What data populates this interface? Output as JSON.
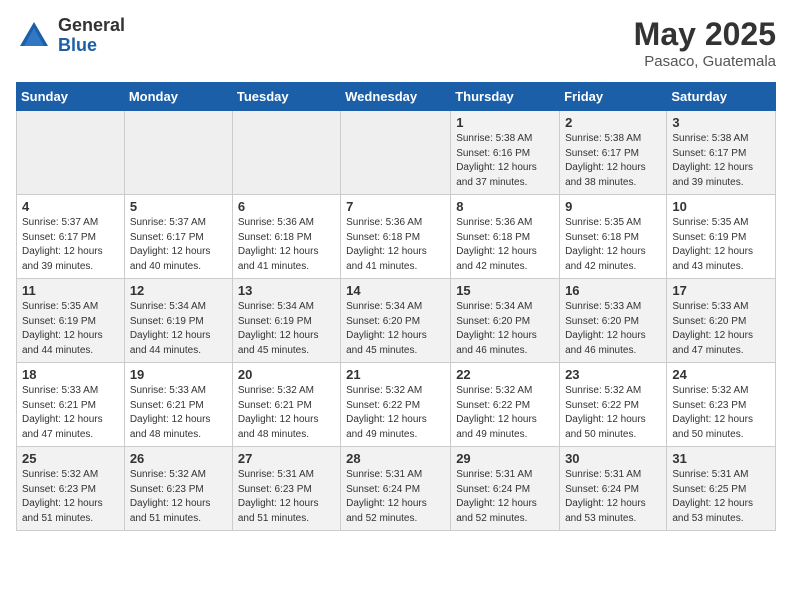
{
  "logo": {
    "general": "General",
    "blue": "Blue"
  },
  "title": "May 2025",
  "location": "Pasaco, Guatemala",
  "days_of_week": [
    "Sunday",
    "Monday",
    "Tuesday",
    "Wednesday",
    "Thursday",
    "Friday",
    "Saturday"
  ],
  "weeks": [
    [
      {
        "day": "",
        "info": ""
      },
      {
        "day": "",
        "info": ""
      },
      {
        "day": "",
        "info": ""
      },
      {
        "day": "",
        "info": ""
      },
      {
        "day": "1",
        "info": "Sunrise: 5:38 AM\nSunset: 6:16 PM\nDaylight: 12 hours\nand 37 minutes."
      },
      {
        "day": "2",
        "info": "Sunrise: 5:38 AM\nSunset: 6:17 PM\nDaylight: 12 hours\nand 38 minutes."
      },
      {
        "day": "3",
        "info": "Sunrise: 5:38 AM\nSunset: 6:17 PM\nDaylight: 12 hours\nand 39 minutes."
      }
    ],
    [
      {
        "day": "4",
        "info": "Sunrise: 5:37 AM\nSunset: 6:17 PM\nDaylight: 12 hours\nand 39 minutes."
      },
      {
        "day": "5",
        "info": "Sunrise: 5:37 AM\nSunset: 6:17 PM\nDaylight: 12 hours\nand 40 minutes."
      },
      {
        "day": "6",
        "info": "Sunrise: 5:36 AM\nSunset: 6:18 PM\nDaylight: 12 hours\nand 41 minutes."
      },
      {
        "day": "7",
        "info": "Sunrise: 5:36 AM\nSunset: 6:18 PM\nDaylight: 12 hours\nand 41 minutes."
      },
      {
        "day": "8",
        "info": "Sunrise: 5:36 AM\nSunset: 6:18 PM\nDaylight: 12 hours\nand 42 minutes."
      },
      {
        "day": "9",
        "info": "Sunrise: 5:35 AM\nSunset: 6:18 PM\nDaylight: 12 hours\nand 42 minutes."
      },
      {
        "day": "10",
        "info": "Sunrise: 5:35 AM\nSunset: 6:19 PM\nDaylight: 12 hours\nand 43 minutes."
      }
    ],
    [
      {
        "day": "11",
        "info": "Sunrise: 5:35 AM\nSunset: 6:19 PM\nDaylight: 12 hours\nand 44 minutes."
      },
      {
        "day": "12",
        "info": "Sunrise: 5:34 AM\nSunset: 6:19 PM\nDaylight: 12 hours\nand 44 minutes."
      },
      {
        "day": "13",
        "info": "Sunrise: 5:34 AM\nSunset: 6:19 PM\nDaylight: 12 hours\nand 45 minutes."
      },
      {
        "day": "14",
        "info": "Sunrise: 5:34 AM\nSunset: 6:20 PM\nDaylight: 12 hours\nand 45 minutes."
      },
      {
        "day": "15",
        "info": "Sunrise: 5:34 AM\nSunset: 6:20 PM\nDaylight: 12 hours\nand 46 minutes."
      },
      {
        "day": "16",
        "info": "Sunrise: 5:33 AM\nSunset: 6:20 PM\nDaylight: 12 hours\nand 46 minutes."
      },
      {
        "day": "17",
        "info": "Sunrise: 5:33 AM\nSunset: 6:20 PM\nDaylight: 12 hours\nand 47 minutes."
      }
    ],
    [
      {
        "day": "18",
        "info": "Sunrise: 5:33 AM\nSunset: 6:21 PM\nDaylight: 12 hours\nand 47 minutes."
      },
      {
        "day": "19",
        "info": "Sunrise: 5:33 AM\nSunset: 6:21 PM\nDaylight: 12 hours\nand 48 minutes."
      },
      {
        "day": "20",
        "info": "Sunrise: 5:32 AM\nSunset: 6:21 PM\nDaylight: 12 hours\nand 48 minutes."
      },
      {
        "day": "21",
        "info": "Sunrise: 5:32 AM\nSunset: 6:22 PM\nDaylight: 12 hours\nand 49 minutes."
      },
      {
        "day": "22",
        "info": "Sunrise: 5:32 AM\nSunset: 6:22 PM\nDaylight: 12 hours\nand 49 minutes."
      },
      {
        "day": "23",
        "info": "Sunrise: 5:32 AM\nSunset: 6:22 PM\nDaylight: 12 hours\nand 50 minutes."
      },
      {
        "day": "24",
        "info": "Sunrise: 5:32 AM\nSunset: 6:23 PM\nDaylight: 12 hours\nand 50 minutes."
      }
    ],
    [
      {
        "day": "25",
        "info": "Sunrise: 5:32 AM\nSunset: 6:23 PM\nDaylight: 12 hours\nand 51 minutes."
      },
      {
        "day": "26",
        "info": "Sunrise: 5:32 AM\nSunset: 6:23 PM\nDaylight: 12 hours\nand 51 minutes."
      },
      {
        "day": "27",
        "info": "Sunrise: 5:31 AM\nSunset: 6:23 PM\nDaylight: 12 hours\nand 51 minutes."
      },
      {
        "day": "28",
        "info": "Sunrise: 5:31 AM\nSunset: 6:24 PM\nDaylight: 12 hours\nand 52 minutes."
      },
      {
        "day": "29",
        "info": "Sunrise: 5:31 AM\nSunset: 6:24 PM\nDaylight: 12 hours\nand 52 minutes."
      },
      {
        "day": "30",
        "info": "Sunrise: 5:31 AM\nSunset: 6:24 PM\nDaylight: 12 hours\nand 53 minutes."
      },
      {
        "day": "31",
        "info": "Sunrise: 5:31 AM\nSunset: 6:25 PM\nDaylight: 12 hours\nand 53 minutes."
      }
    ]
  ]
}
